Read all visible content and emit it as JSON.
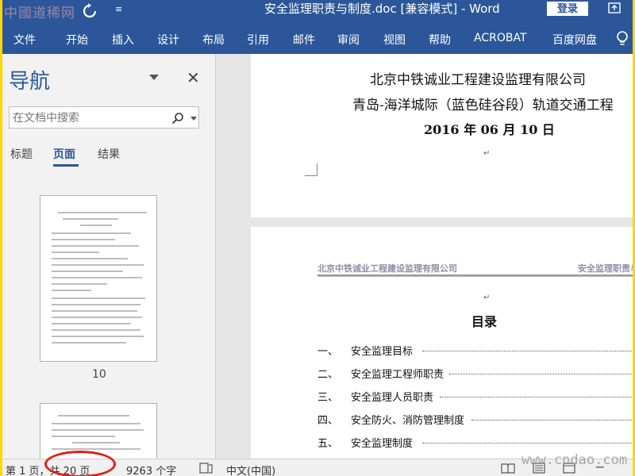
{
  "titlebar": {
    "watermark": "中國道稀网",
    "title": "安全监理职责与制度.doc [兼容模式] - Word",
    "login": "登录"
  },
  "ribbon": {
    "tabs": [
      "文件",
      "开始",
      "插入",
      "设计",
      "布局",
      "引用",
      "邮件",
      "审阅",
      "视图",
      "帮助",
      "ACROBAT",
      "百度网盘"
    ]
  },
  "nav": {
    "title": "导航",
    "search_placeholder": "在文档中搜索",
    "tabs": [
      "标题",
      "页面",
      "结果"
    ],
    "active_tab": "页面",
    "thumbnail_label": "10"
  },
  "document": {
    "company": "北京中铁诚业工程建设监理有限公司",
    "project": "青岛-海洋城际（蓝色硅谷段）轨道交通工程",
    "date": "2016 年 06 月 10 日",
    "header_left": "北京中铁诚业工程建设监理有限公司",
    "header_right": "安全监理职责与",
    "toc_title": "目录",
    "toc": [
      {
        "num": "一、",
        "text": "安全监理目标"
      },
      {
        "num": "二、",
        "text": "安全监理工程师职责"
      },
      {
        "num": "三、",
        "text": "安全监理人员职责"
      },
      {
        "num": "四、",
        "text": "安全防火、消防管理制度"
      },
      {
        "num": "五、",
        "text": "安全监理制度"
      }
    ]
  },
  "status": {
    "page": "第 1 页，共 20 页",
    "words": "9263 个字",
    "language": "中文(中国)",
    "watermark": "www.cndao.com"
  },
  "colors": {
    "brand": "#2b579a",
    "highlight": "#e0201b",
    "frame": "#ffd700"
  }
}
